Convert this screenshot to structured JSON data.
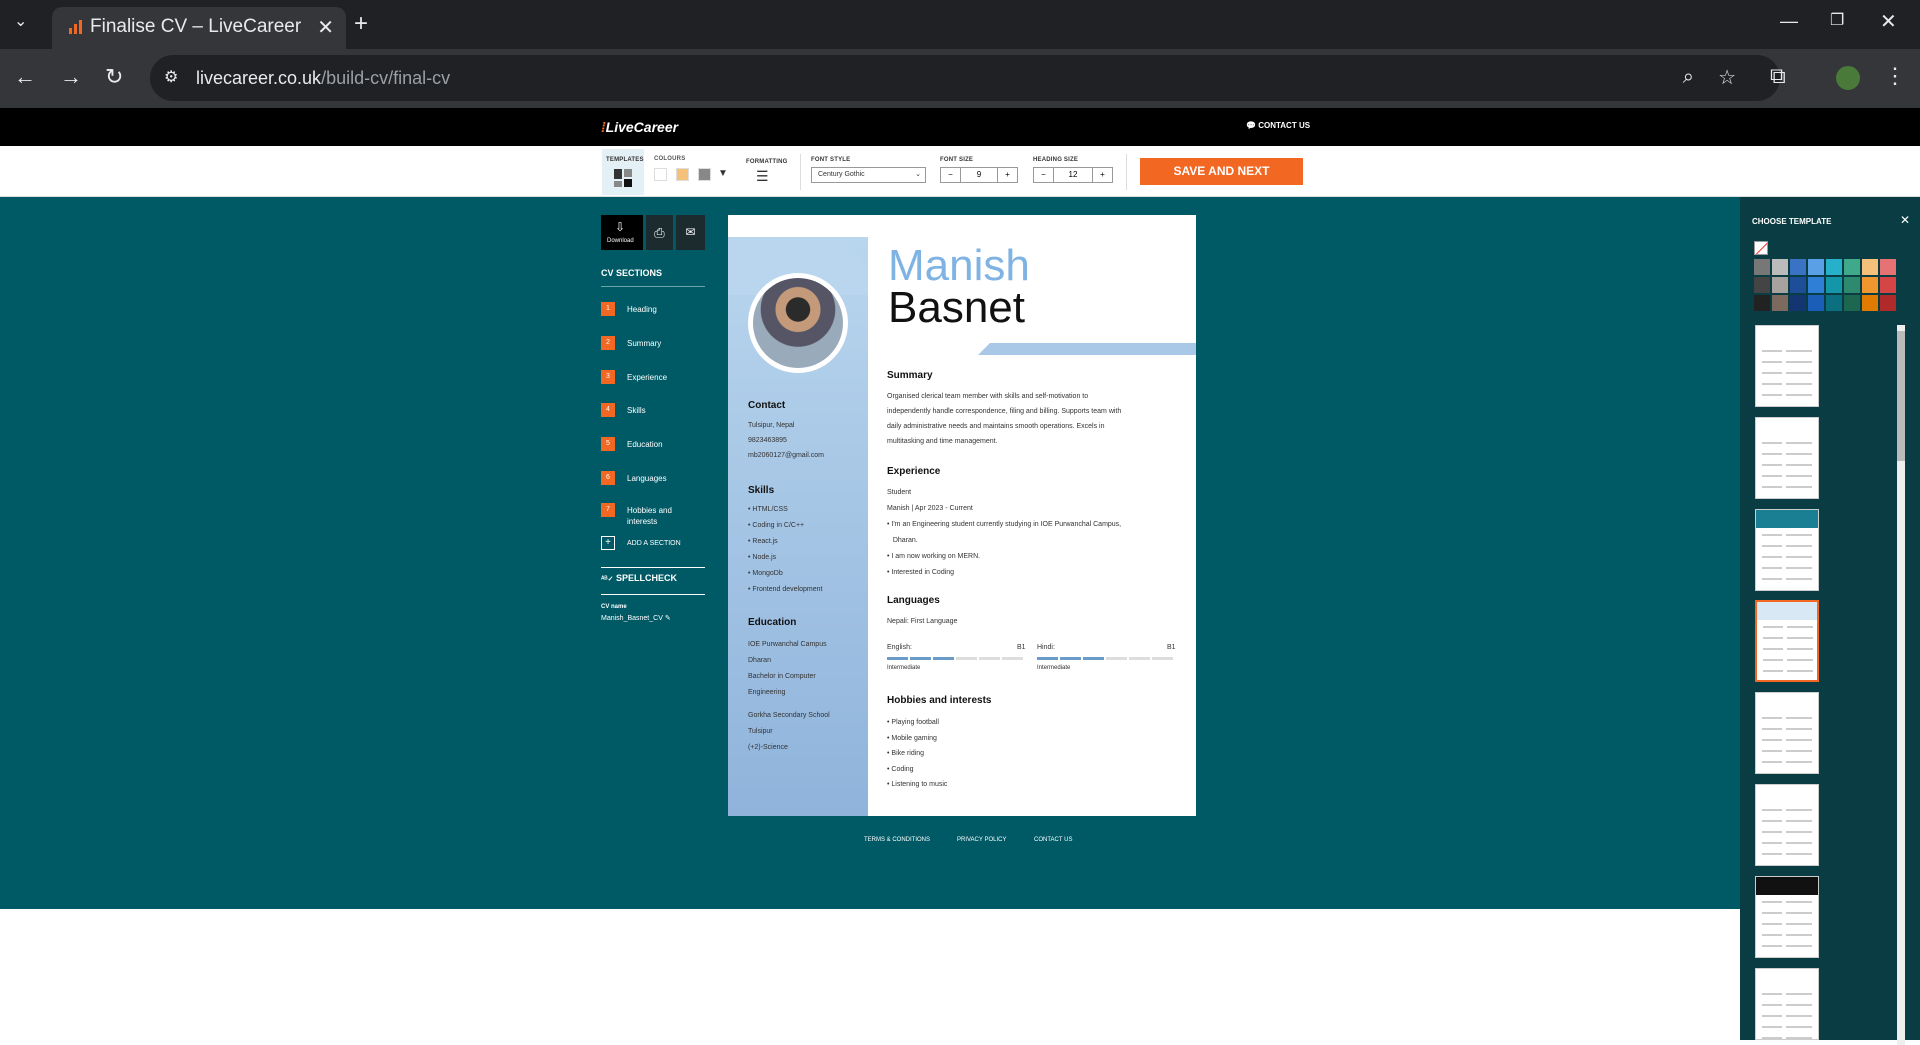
{
  "browser": {
    "tab_title": "Finalise CV – LiveCareer",
    "url_host": "livecareer.co.uk",
    "url_path": "/build-cv/final-cv"
  },
  "header": {
    "logo": "LiveCareer",
    "contact": "CONTACT US"
  },
  "toolbar": {
    "templates": "TEMPLATES",
    "colours": "COLOURS",
    "formatting": "FORMATTING",
    "font_style_label": "FONT STYLE",
    "font_style_value": "Century Gothic",
    "font_size_label": "FONT SIZE",
    "font_size_value": "9",
    "heading_size_label": "HEADING SIZE",
    "heading_size_value": "12",
    "save_next": "SAVE AND NEXT",
    "colour_swatches": [
      "#ffffff",
      "#f5c07a",
      "#888888"
    ]
  },
  "sidebar": {
    "download": "Download",
    "sections_title": "CV SECTIONS",
    "sections": [
      {
        "n": "1",
        "label": "Heading"
      },
      {
        "n": "2",
        "label": "Summary"
      },
      {
        "n": "3",
        "label": "Experience"
      },
      {
        "n": "4",
        "label": "Skills"
      },
      {
        "n": "5",
        "label": "Education"
      },
      {
        "n": "6",
        "label": "Languages"
      },
      {
        "n": "7",
        "label": "Hobbies and interests"
      }
    ],
    "add_section": "ADD A SECTION",
    "spellcheck": "SPELLCHECK",
    "cv_name_label": "CV name",
    "cv_name": "Manish_Basnet_CV"
  },
  "cv": {
    "first_name": "Manish",
    "last_name": "Basnet",
    "contact_title": "Contact",
    "contact": [
      "Tulsipur, Nepal",
      "9823463895",
      "mb2060127@gmail.com"
    ],
    "skills_title": "Skills",
    "skills": [
      "• HTML/CSS",
      "• Coding in C/C++",
      "• React.js",
      "• Node.js",
      "• MongoDb",
      "• Frontend development"
    ],
    "education_title": "Education",
    "education1": [
      "IOE Purwanchal Campus",
      "Dharan",
      "Bachelor in Computer",
      "Engineering"
    ],
    "education2": [
      "Gorkha Secondary School",
      "Tulsipur",
      "(+2)-Science"
    ],
    "summary_title": "Summary",
    "summary": [
      "Organised clerical team member with skills and self-motivation to",
      "independently handle correspondence, filing and billing. Supports team with",
      "daily administrative needs and maintains smooth operations. Excels in",
      "multitasking and time management."
    ],
    "experience_title": "Experience",
    "experience_role": "Student",
    "experience_meta": "Manish | Apr 2023 - Current",
    "experience_points": [
      "• I'm an Engineering student currently studying in IOE Purwanchal Campus,",
      "   Dharan.",
      "• I am now working on MERN.",
      "• Interested in Coding"
    ],
    "languages_title": "Languages",
    "native": "Nepali: First Language",
    "lang1": "English:",
    "lang1_level": "B1",
    "lang1_desc": "Intermediate",
    "lang1_fill": 0.5,
    "lang2": "Hindi:",
    "lang2_level": "B1",
    "lang2_desc": "Intermediate",
    "lang2_fill": 0.5,
    "hobbies_title": "Hobbies and interests",
    "hobbies": [
      "• Playing football",
      "• Mobile gaming",
      "• Bike riding",
      "• Coding",
      "• Listening to music"
    ]
  },
  "footer": {
    "terms": "TERMS & CONDITIONS",
    "privacy": "PRIVACY POLICY",
    "contact": "CONTACT US"
  },
  "panel": {
    "title": "CHOOSE TEMPLATE",
    "palette": [
      [
        "#777777",
        "#bbbbbb",
        "#3b73c4",
        "#5aa0e6",
        "#27b0c9",
        "#3fa98a",
        "#f5c07a",
        "#e57373"
      ],
      [
        "#444444",
        "#a8a29e",
        "#1f4e99",
        "#2f7fd6",
        "#1396a8",
        "#2d8a6e",
        "#f0962e",
        "#d64545"
      ],
      [
        "#222222",
        "#7c6a5e",
        "#143670",
        "#1a5eb8",
        "#0b6f80",
        "#1d6650",
        "#e07b00",
        "#b02a2a"
      ]
    ]
  }
}
